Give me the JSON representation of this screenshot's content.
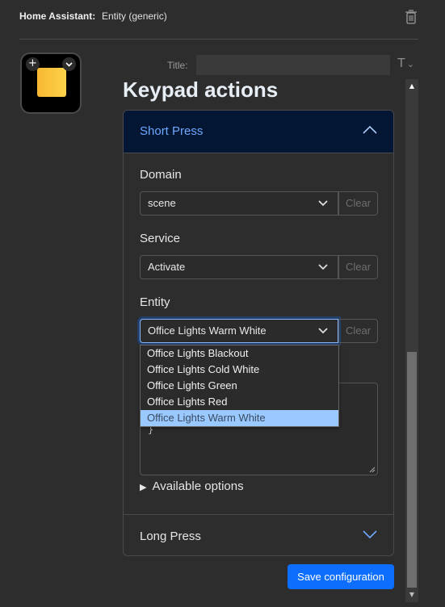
{
  "header": {
    "label": "Home Assistant:",
    "value": "Entity (generic)",
    "delete_icon": "trash-icon"
  },
  "key_preview": {
    "tile_color": "#fdc83d",
    "add_icon": "plus-icon",
    "menu_icon": "chevron-down-icon"
  },
  "title_row": {
    "label": "Title:",
    "value": "",
    "format_label": "T",
    "format_icon": "chevron-down-icon"
  },
  "heading": "Keypad actions",
  "accordion": {
    "short_press": {
      "label": "Short Press",
      "expanded": true,
      "fields": {
        "domain": {
          "label": "Domain",
          "value": "scene",
          "clear_label": "Clear"
        },
        "service": {
          "label": "Service",
          "value": "Activate",
          "clear_label": "Clear"
        },
        "entity": {
          "label": "Entity",
          "value": "Office Lights Warm White",
          "clear_label": "Clear",
          "options": [
            "Office Lights Blackout",
            "Office Lights Cold White",
            "Office Lights Green",
            "Office Lights Red",
            "Office Lights Warm White"
          ],
          "selected_index": 4
        },
        "data_textarea": {
          "visible_text": "}"
        },
        "available_options": "Available options"
      }
    },
    "long_press": {
      "label": "Long Press",
      "expanded": false
    }
  },
  "save_button": "Save configuration",
  "colors": {
    "accent": "#0d6efd",
    "accordion_active_bg": "#031633",
    "accordion_active_text": "#6ea8fe",
    "selected_option_bg": "#99c9ff"
  }
}
